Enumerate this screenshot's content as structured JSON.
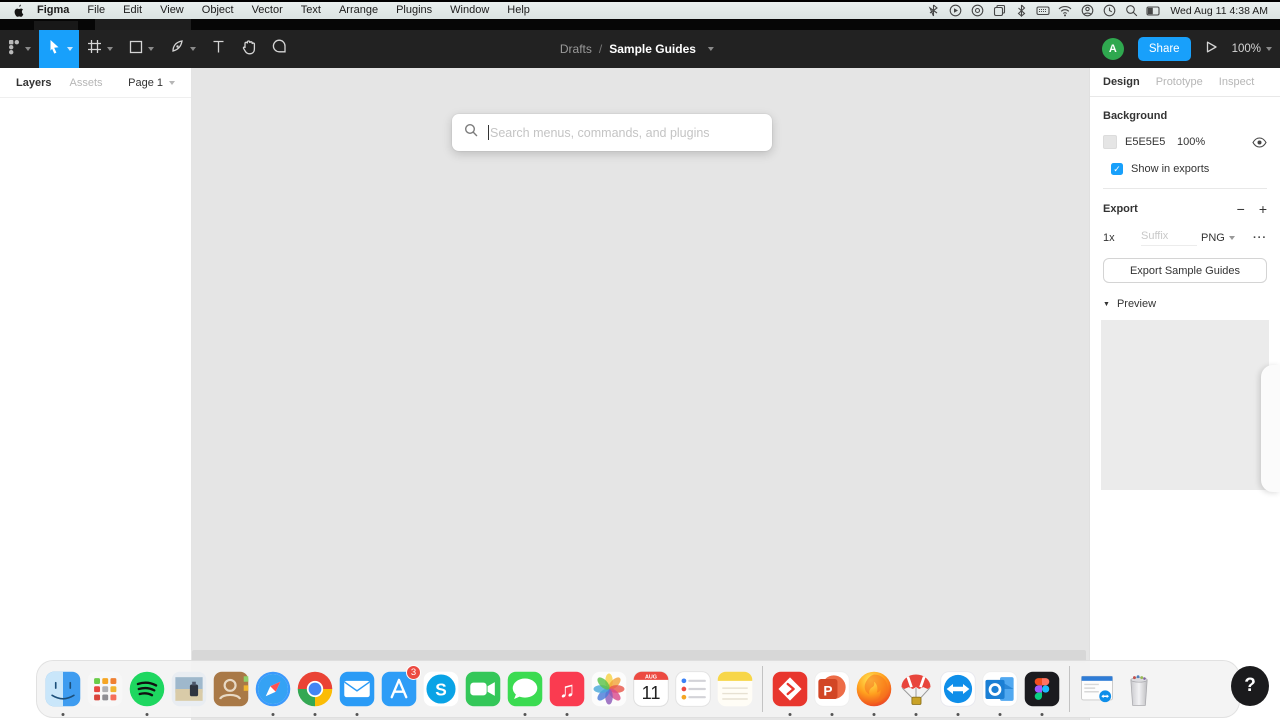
{
  "colors": {
    "accent": "#18A0FB",
    "canvas_bg": "#E5E5E5",
    "toolbar_bg": "#222222",
    "avatar_green": "#2fa84f"
  },
  "menubar": {
    "apple_menu": "apple-logo",
    "items": [
      "Figma",
      "File",
      "Edit",
      "View",
      "Object",
      "Vector",
      "Text",
      "Arrange",
      "Plugins",
      "Window",
      "Help"
    ],
    "status_icons": [
      "zipper",
      "playcircle",
      "qcircle",
      "copywin",
      "bluetooth",
      "keyboard",
      "wifi",
      "usercircle",
      "clock",
      "search",
      "display"
    ],
    "clock": "Wed Aug 11  4:38 AM"
  },
  "toolbar": {
    "tools": [
      "figma-menu",
      "move",
      "frame",
      "shape",
      "pen",
      "text",
      "hand",
      "comment"
    ],
    "selected_tool": "move",
    "breadcrumb": {
      "location": "Drafts",
      "separator": "/",
      "title": "Sample Guides"
    },
    "avatar_initial": "A",
    "share_label": "Share",
    "present_icon": "play",
    "zoom_level": "100%"
  },
  "left_panel": {
    "tab_layers": "Layers",
    "tab_assets": "Assets",
    "page_selector": "Page 1"
  },
  "canvas": {
    "search_placeholder": "Search menus, commands, and plugins"
  },
  "right_panel": {
    "tab_design": "Design",
    "tab_prototype": "Prototype",
    "tab_inspect": "Inspect",
    "background": {
      "title": "Background",
      "hex": "E5E5E5",
      "opacity": "100%",
      "checkbox_label": "Show in exports",
      "checkbox_checked": true
    },
    "export": {
      "title": "Export",
      "minus": "−",
      "plus": "+",
      "scale": "1x",
      "suffix_placeholder": "Suffix",
      "format": "PNG",
      "more": "···",
      "button_label": "Export Sample Guides"
    },
    "preview": {
      "title": "Preview",
      "collapse_tri": "▼"
    }
  },
  "dock": {
    "items": [
      {
        "icon": "finder",
        "running": true
      },
      {
        "icon": "launchpad",
        "running": false
      },
      {
        "icon": "spotify",
        "running": true
      },
      {
        "icon": "preview",
        "running": false
      },
      {
        "icon": "contacts",
        "running": false
      },
      {
        "icon": "safari",
        "running": true
      },
      {
        "icon": "chrome",
        "running": true
      },
      {
        "icon": "mail",
        "running": true
      },
      {
        "icon": "appstore",
        "running": false,
        "badge": "3"
      },
      {
        "icon": "skype",
        "running": false
      },
      {
        "icon": "facetime",
        "running": false
      },
      {
        "icon": "messages",
        "running": true
      },
      {
        "icon": "music",
        "running": true
      },
      {
        "icon": "photos",
        "running": false
      },
      {
        "icon": "calendar",
        "running": false,
        "month": "AUG",
        "day": "11"
      },
      {
        "icon": "reminders",
        "running": false
      },
      {
        "icon": "notes",
        "running": false
      },
      {
        "type": "separator"
      },
      {
        "icon": "pdfexpert",
        "running": true
      },
      {
        "icon": "powerpoint",
        "running": true
      },
      {
        "icon": "firefox",
        "running": true
      },
      {
        "icon": "installer",
        "running": true
      },
      {
        "icon": "teamviewer",
        "running": true
      },
      {
        "icon": "outlook",
        "running": true
      },
      {
        "icon": "figma",
        "running": true
      },
      {
        "type": "separator"
      },
      {
        "icon": "minimized-window",
        "running": false
      },
      {
        "icon": "trash",
        "running": false
      }
    ],
    "help_label": "?"
  }
}
